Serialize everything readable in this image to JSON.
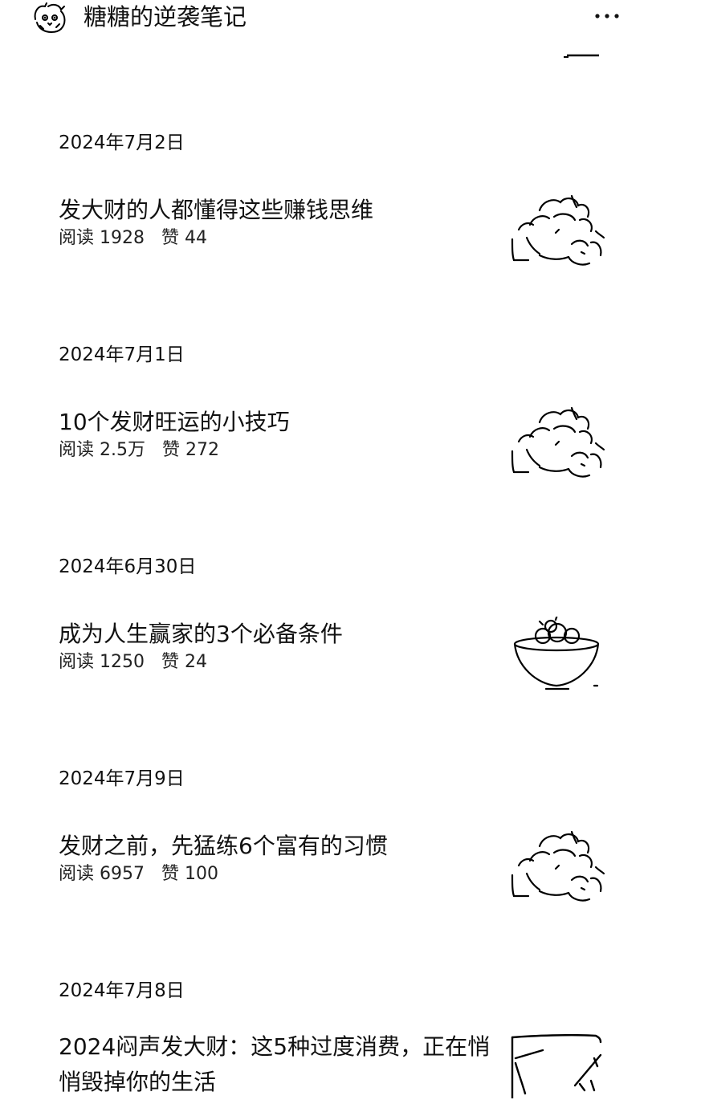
{
  "header": {
    "account_name": "糖糖的逆袭笔记",
    "avatar_icon": "cat-avatar-icon",
    "more_icon": "more-dots-icon"
  },
  "feed": [
    {
      "date": "2024年7月2日",
      "title": "发大财的人都懂得这些赚钱思维",
      "read_label": "阅读",
      "read_count": "1928",
      "like_label": "赞",
      "like_count": "44",
      "thumbnail": "fruit-pile-sketch"
    },
    {
      "date": "2024年7月1日",
      "title": "10个发财旺运的小技巧",
      "read_label": "阅读",
      "read_count": "2.5万",
      "like_label": "赞",
      "like_count": "272",
      "thumbnail": "fruit-pile-sketch"
    },
    {
      "date": "2024年6月30日",
      "title": "成为人生赢家的3个必备条件",
      "read_label": "阅读",
      "read_count": "1250",
      "like_label": "赞",
      "like_count": "24",
      "thumbnail": "fruit-bowl-sketch"
    },
    {
      "date": "2024年7月9日",
      "title": "发财之前，先猛练6个富有的习惯",
      "read_label": "阅读",
      "read_count": "6957",
      "like_label": "赞",
      "like_count": "100",
      "thumbnail": "fruit-pile-sketch"
    },
    {
      "date": "2024年7月8日",
      "title": "2024闷声发大财：这5种过度消费，正在悄悄毁掉你的生活",
      "thumbnail": "frame-sketch"
    }
  ]
}
